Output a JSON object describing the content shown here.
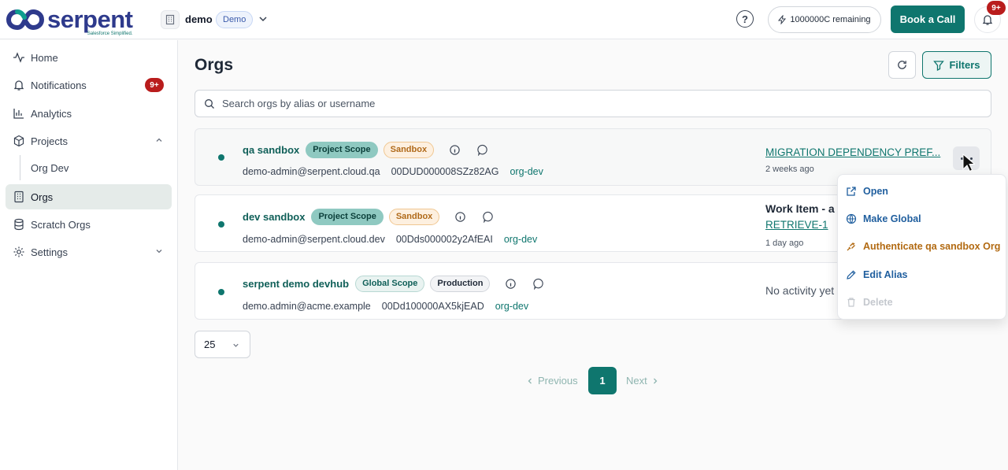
{
  "brand": {
    "name": "serpent",
    "tagline": "Salesforce Simplified."
  },
  "workspace": {
    "name": "demo",
    "badge": "Demo"
  },
  "header": {
    "credits_label": "1000000C remaining",
    "book_call_label": "Book a Call",
    "notif_badge": "9+"
  },
  "sidebar": {
    "items": [
      {
        "label": "Home",
        "icon": "activity-icon"
      },
      {
        "label": "Notifications",
        "icon": "bell-icon",
        "badge": "9+"
      },
      {
        "label": "Analytics",
        "icon": "bar-chart-icon"
      },
      {
        "label": "Projects",
        "icon": "cube-icon"
      },
      {
        "label": "Org Dev"
      },
      {
        "label": "Orgs",
        "icon": "building-icon"
      },
      {
        "label": "Scratch Orgs",
        "icon": "database-icon"
      },
      {
        "label": "Settings",
        "icon": "gear-icon"
      }
    ]
  },
  "main": {
    "title": "Orgs",
    "filters_label": "Filters",
    "search_placeholder": "Search orgs by alias or username"
  },
  "orgs": [
    {
      "name": "qa sandbox",
      "scope": "Project Scope",
      "type": "Sandbox",
      "username": "demo-admin@serpent.cloud.qa",
      "org_id": "00DUD000008SZz82AG",
      "tag": "org-dev",
      "activity_link": "MIGRATION DEPENDENCY PREF...",
      "activity_time": "2 weeks ago"
    },
    {
      "name": "dev sandbox",
      "scope": "Project Scope",
      "type": "Sandbox",
      "username": "demo-admin@serpent.cloud.dev",
      "org_id": "00Dds000002y2AfEAI",
      "tag": "org-dev",
      "activity_title": "Work Item - a",
      "activity_link": "RETRIEVE-1",
      "activity_time": "1 day ago"
    },
    {
      "name": "serpent demo devhub",
      "scope": "Global Scope",
      "type": "Production",
      "username": "demo.admin@acme.example",
      "org_id": "00Dd100000AX5kjEAD",
      "tag": "org-dev",
      "activity_none": "No activity yet"
    }
  ],
  "pagination": {
    "page_size": "25",
    "previous": "Previous",
    "current": "1",
    "next": "Next"
  },
  "context_menu": {
    "open": "Open",
    "make_global": "Make Global",
    "authenticate": "Authenticate qa sandbox Org",
    "edit_alias": "Edit Alias",
    "delete": "Delete"
  },
  "colors": {
    "primary": "#0f766e",
    "brand_text": "#2e3a8c",
    "badge_red": "#b91c1c",
    "menu_link": "#1f5e9e",
    "warn": "#b26a12"
  }
}
